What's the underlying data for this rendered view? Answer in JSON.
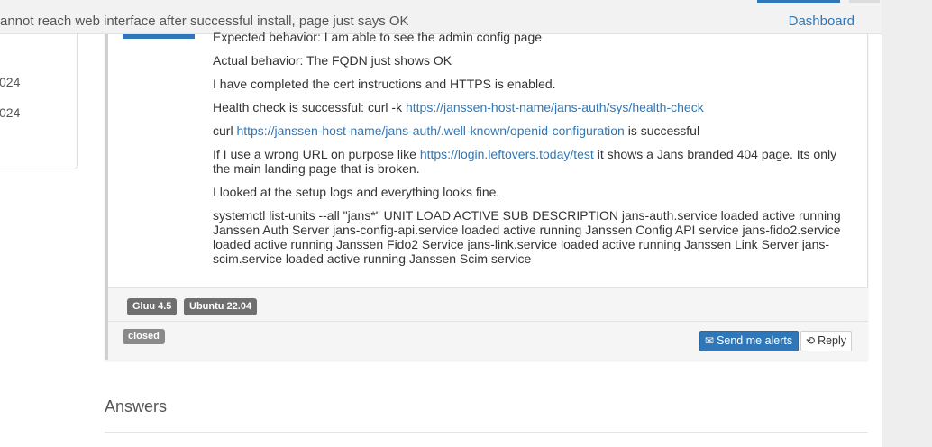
{
  "header": {
    "topic_title": "annot reach web interface after successful install, page just says OK",
    "dashboard_link": "Dashboard"
  },
  "sidebar": {
    "dates": [
      "024",
      "024"
    ]
  },
  "question": {
    "paragraphs": {
      "expected": "Expected behavior: I am able to see the admin config page",
      "actual": "Actual behavior: The FQDN just shows OK",
      "cert": "I have completed the cert instructions and HTTPS is enabled.",
      "health_prefix": "Health check is successful: curl -k ",
      "health_link": "https://janssen-host-name/jans-auth/sys/health-check",
      "curl_prefix": "curl ",
      "curl_link": "https://janssen-host-name/jans-auth/.well-known/openid-configuration",
      "curl_suffix": " is successful",
      "wrong_prefix": "If I use a wrong URL on purpose like ",
      "wrong_link": "https://login.leftovers.today/test",
      "wrong_suffix": " it shows a Jans branded 404 page. Its only the main landing page that is broken.",
      "logs": "I looked at the setup logs and everything looks fine.",
      "systemctl": "systemctl list-units --all \"jans*\" UNIT LOAD ACTIVE SUB DESCRIPTION jans-auth.service loaded active running Janssen Auth Server jans-config-api.service loaded active running Janssen Config API service jans-fido2.service loaded active running Janssen Fido2 Service jans-link.service loaded active running Janssen Link Server jans-scim.service loaded active running Janssen Scim service"
    },
    "tags": [
      "Gluu 4.5",
      "Ubuntu 22.04"
    ],
    "status": "closed",
    "actions": {
      "alerts_label": "Send me alerts",
      "reply_label": "Reply"
    }
  },
  "answers": {
    "heading": "Answers"
  },
  "icons": {
    "alerts": "envelope-icon",
    "reply": "retweet-icon"
  },
  "colors": {
    "accent": "#2f77b8",
    "tag_bg": "#6f6f6f",
    "status_bg": "#8a8a8a"
  }
}
